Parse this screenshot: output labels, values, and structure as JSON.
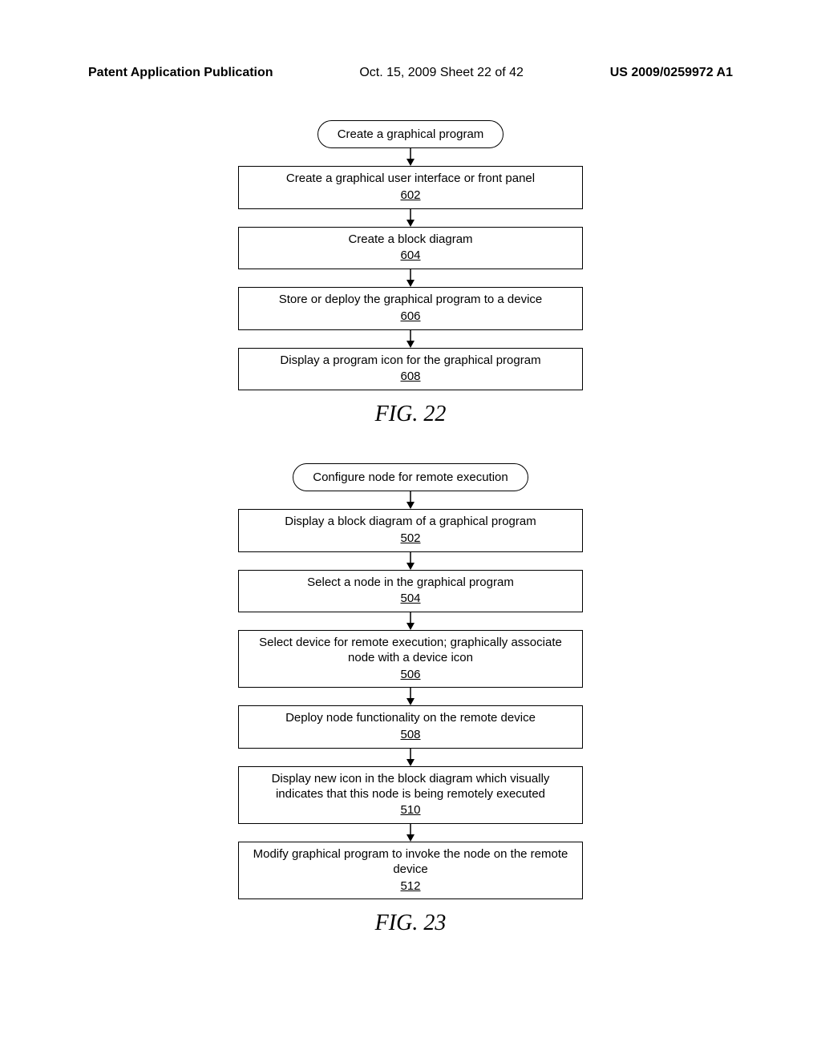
{
  "header": {
    "left": "Patent Application Publication",
    "mid": "Oct. 15, 2009  Sheet 22 of 42",
    "right": "US 2009/0259972 A1"
  },
  "fig22": {
    "terminator": "Create a graphical program",
    "steps": [
      {
        "text": "Create a graphical user interface or front panel",
        "ref": "602"
      },
      {
        "text": "Create a block diagram",
        "ref": "604"
      },
      {
        "text": "Store or deploy the graphical program to a device",
        "ref": "606"
      },
      {
        "text": "Display a program icon for the graphical program",
        "ref": "608"
      }
    ],
    "caption": "FIG. 22"
  },
  "fig23": {
    "terminator": "Configure node for remote execution",
    "steps": [
      {
        "text": "Display a block diagram of a graphical program",
        "ref": "502"
      },
      {
        "text": "Select a node in the graphical program",
        "ref": "504"
      },
      {
        "text": "Select device for remote execution; graphically associate node with a device icon",
        "ref": "506"
      },
      {
        "text": "Deploy node functionality on the remote device",
        "ref": "508"
      },
      {
        "text": "Display new icon in the block diagram which visually indicates that this node is being remotely executed",
        "ref": "510"
      },
      {
        "text": "Modify graphical program to invoke the node on the remote device",
        "ref": "512"
      }
    ],
    "caption": "FIG. 23"
  }
}
